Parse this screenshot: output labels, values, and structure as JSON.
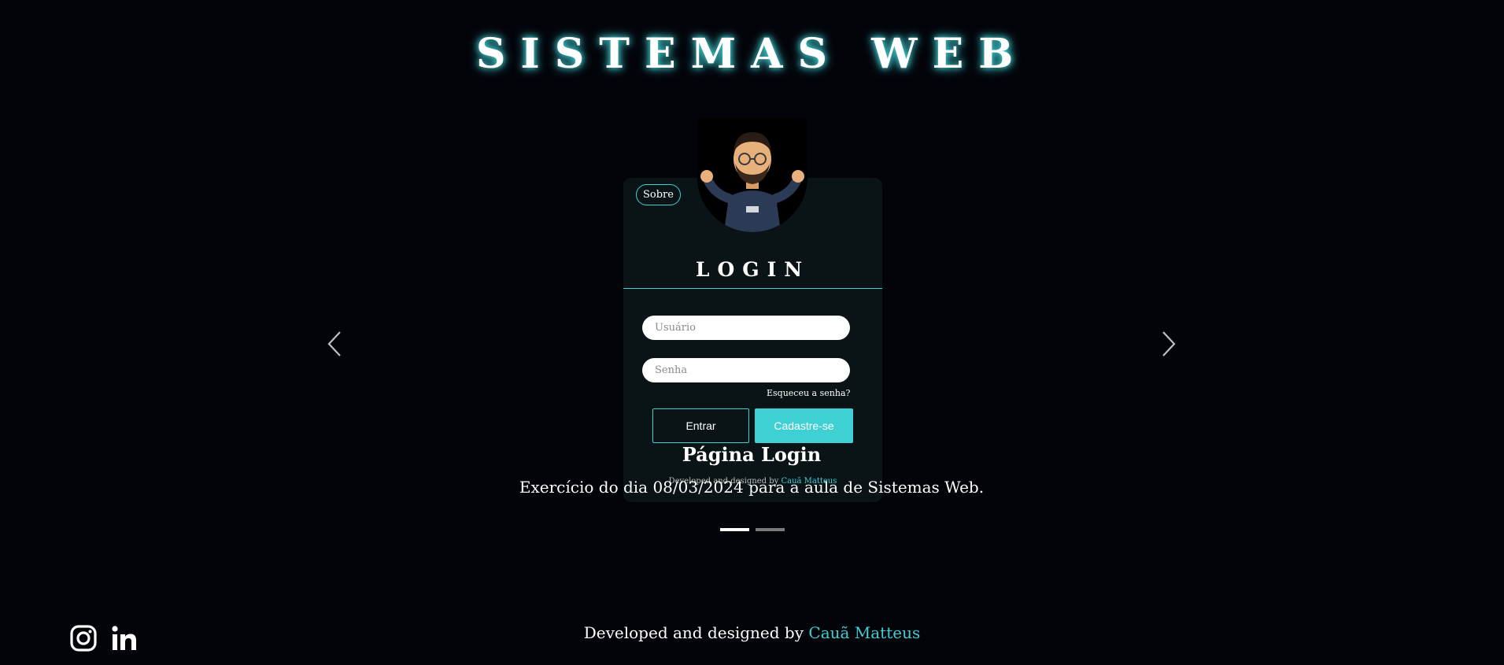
{
  "header": {
    "title": "SISTEMAS WEB"
  },
  "carousel": {
    "prev_icon": "chevron-left-icon",
    "next_icon": "chevron-right-icon",
    "slide": {
      "image": {
        "sobre_label": "Sobre",
        "login_title": "LOGIN",
        "user_placeholder": "Usuário",
        "pass_placeholder": "Senha",
        "forgot_label": "Esqueceu a senha?",
        "entrar_label": "Entrar",
        "cadastre_label": "Cadastre-se",
        "footer_prefix": "Developed and designed by",
        "footer_author": "Cauã Matteus"
      },
      "caption_title": "Página Login",
      "caption_text": "Exercício do dia 08/03/2024 para a aula de Sistemas Web."
    },
    "indicators": {
      "count": 2,
      "active": 0
    }
  },
  "footer": {
    "credit_prefix": "Developed and designed by",
    "credit_author": "Cauã Matteus",
    "social": [
      {
        "icon": "instagram-icon"
      },
      {
        "icon": "linkedin-icon"
      }
    ]
  },
  "colors": {
    "accent": "#3fd0d4",
    "background": "#03040a",
    "card": "#0a1316"
  }
}
